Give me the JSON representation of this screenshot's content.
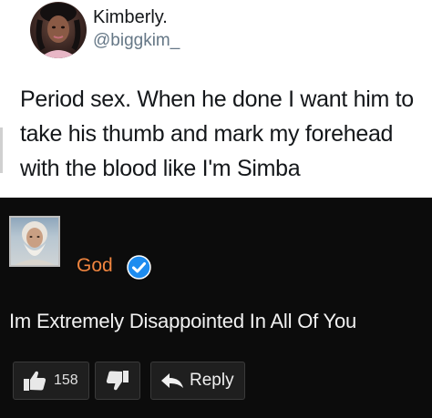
{
  "tweet": {
    "display_name": "Kimberly.",
    "handle": "@biggkim_",
    "text": "Period sex. When he done I want him to take his thumb and mark my forehead with the blood like I'm Simba"
  },
  "comment": {
    "author": "God",
    "verified": true,
    "text": "Im Extremely Disappointed In All Of You",
    "like_count": "158",
    "reply_label": "Reply"
  },
  "colors": {
    "comment_bg": "#0c0c0c",
    "author_name": "#f0853f",
    "verified_badge": "#1d8cf0",
    "button_bg": "#1f1f1f"
  },
  "icons": {
    "like": "thumbs-up-icon",
    "dislike": "thumbs-down-icon",
    "reply": "reply-arrow-icon",
    "verified": "verified-check-icon"
  }
}
